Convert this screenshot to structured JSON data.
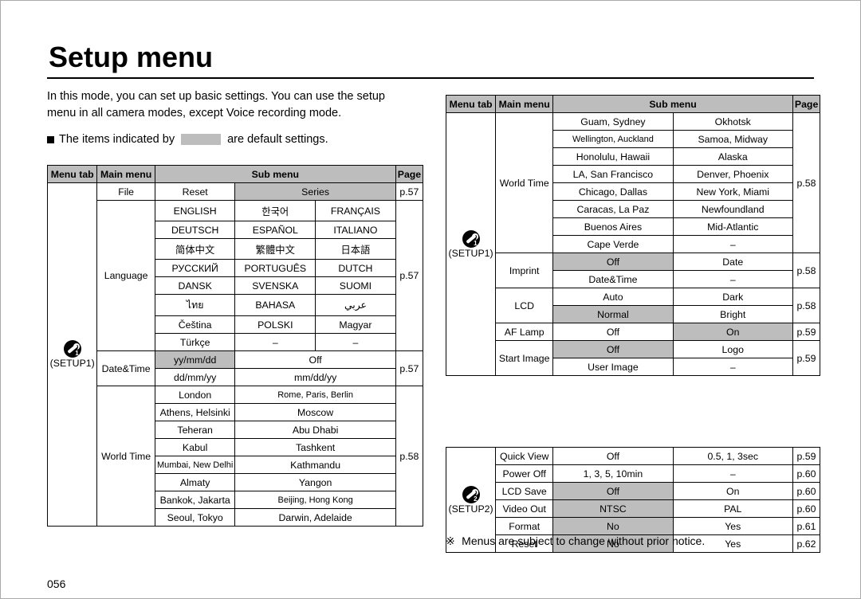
{
  "title": "Setup menu",
  "intro": "In this mode, you can set up basic settings. You can use the setup menu in all camera modes, except Voice recording mode.",
  "bullet_pre": "The items indicated by",
  "bullet_post": "are default settings.",
  "headers": {
    "tab": "Menu tab",
    "main": "Main menu",
    "sub": "Sub menu",
    "page": "Page"
  },
  "setup1_label": "(SETUP1)",
  "setup2_label": "(SETUP2)",
  "left": {
    "file": {
      "name": "File",
      "opts": [
        "Reset",
        "Series"
      ],
      "page": "p.57"
    },
    "language": {
      "name": "Language",
      "rows": [
        [
          "ENGLISH",
          "한국어",
          "FRANÇAIS"
        ],
        [
          "DEUTSCH",
          "ESPAÑOL",
          "ITALIANO"
        ],
        [
          "简体中文",
          "繁體中文",
          "日本語"
        ],
        [
          "РУССКИЙ",
          "PORTUGUÊS",
          "DUTCH"
        ],
        [
          "DANSK",
          "SVENSKA",
          "SUOMI"
        ],
        [
          "ไทย",
          "BAHASA",
          "عربي"
        ],
        [
          "Čeština",
          "POLSKI",
          "Magyar"
        ],
        [
          "Türkçe",
          "–",
          "–"
        ]
      ],
      "page": "p.57"
    },
    "datetime": {
      "name": "Date&Time",
      "rows": [
        [
          "yy/mm/dd",
          "Off"
        ],
        [
          "dd/mm/yy",
          "mm/dd/yy"
        ]
      ],
      "page": "p.57"
    },
    "worldtimeA": {
      "name": "World Time",
      "rows": [
        [
          "London",
          "Rome, Paris, Berlin"
        ],
        [
          "Athens, Helsinki",
          "Moscow"
        ],
        [
          "Teheran",
          "Abu Dhabi"
        ],
        [
          "Kabul",
          "Tashkent"
        ],
        [
          "Mumbai, New Delhi",
          "Kathmandu"
        ],
        [
          "Almaty",
          "Yangon"
        ],
        [
          "Bankok, Jakarta",
          "Beijing, Hong Kong"
        ],
        [
          "Seoul, Tokyo",
          "Darwin, Adelaide"
        ]
      ],
      "page": "p.58"
    }
  },
  "right": {
    "worldtimeB": {
      "name": "World Time",
      "rows": [
        [
          "Guam, Sydney",
          "Okhotsk"
        ],
        [
          "Wellington, Auckland",
          "Samoa, Midway"
        ],
        [
          "Honolulu, Hawaii",
          "Alaska"
        ],
        [
          "LA, San Francisco",
          "Denver, Phoenix"
        ],
        [
          "Chicago, Dallas",
          "New York, Miami"
        ],
        [
          "Caracas, La Paz",
          "Newfoundland"
        ],
        [
          "Buenos Aires",
          "Mid-Atlantic"
        ],
        [
          "Cape Verde",
          "–"
        ]
      ],
      "page": "p.58"
    },
    "imprint": {
      "name": "Imprint",
      "rows": [
        [
          "Off",
          "Date"
        ],
        [
          "Date&Time",
          "–"
        ]
      ],
      "page": "p.58"
    },
    "lcd": {
      "name": "LCD",
      "rows": [
        [
          "Auto",
          "Dark"
        ],
        [
          "Normal",
          "Bright"
        ]
      ],
      "page": "p.58"
    },
    "af": {
      "name": "AF Lamp",
      "opts": [
        "Off",
        "On"
      ],
      "page": "p.59"
    },
    "start": {
      "name": "Start Image",
      "rows": [
        [
          "Off",
          "Logo"
        ],
        [
          "User Image",
          "–"
        ]
      ],
      "page": "p.59"
    },
    "setup2_rows": [
      {
        "name": "Quick View",
        "a": "Off",
        "b": "0.5, 1, 3sec",
        "page": "p.59",
        "def_a": false,
        "def_b": false
      },
      {
        "name": "Power Off",
        "a": "1, 3, 5, 10min",
        "b": "–",
        "page": "p.60",
        "def_a": false,
        "def_b": false
      },
      {
        "name": "LCD Save",
        "a": "Off",
        "b": "On",
        "page": "p.60",
        "def_a": true,
        "def_b": false
      },
      {
        "name": "Video Out",
        "a": "NTSC",
        "b": "PAL",
        "page": "p.60",
        "def_a": true,
        "def_b": false
      },
      {
        "name": "Format",
        "a": "No",
        "b": "Yes",
        "page": "p.61",
        "def_a": true,
        "def_b": false
      },
      {
        "name": "Reset",
        "a": "No",
        "b": "Yes",
        "page": "p.62",
        "def_a": true,
        "def_b": false
      }
    ]
  },
  "footnote": "Menus are subject to change without prior notice.",
  "page_number": "056"
}
